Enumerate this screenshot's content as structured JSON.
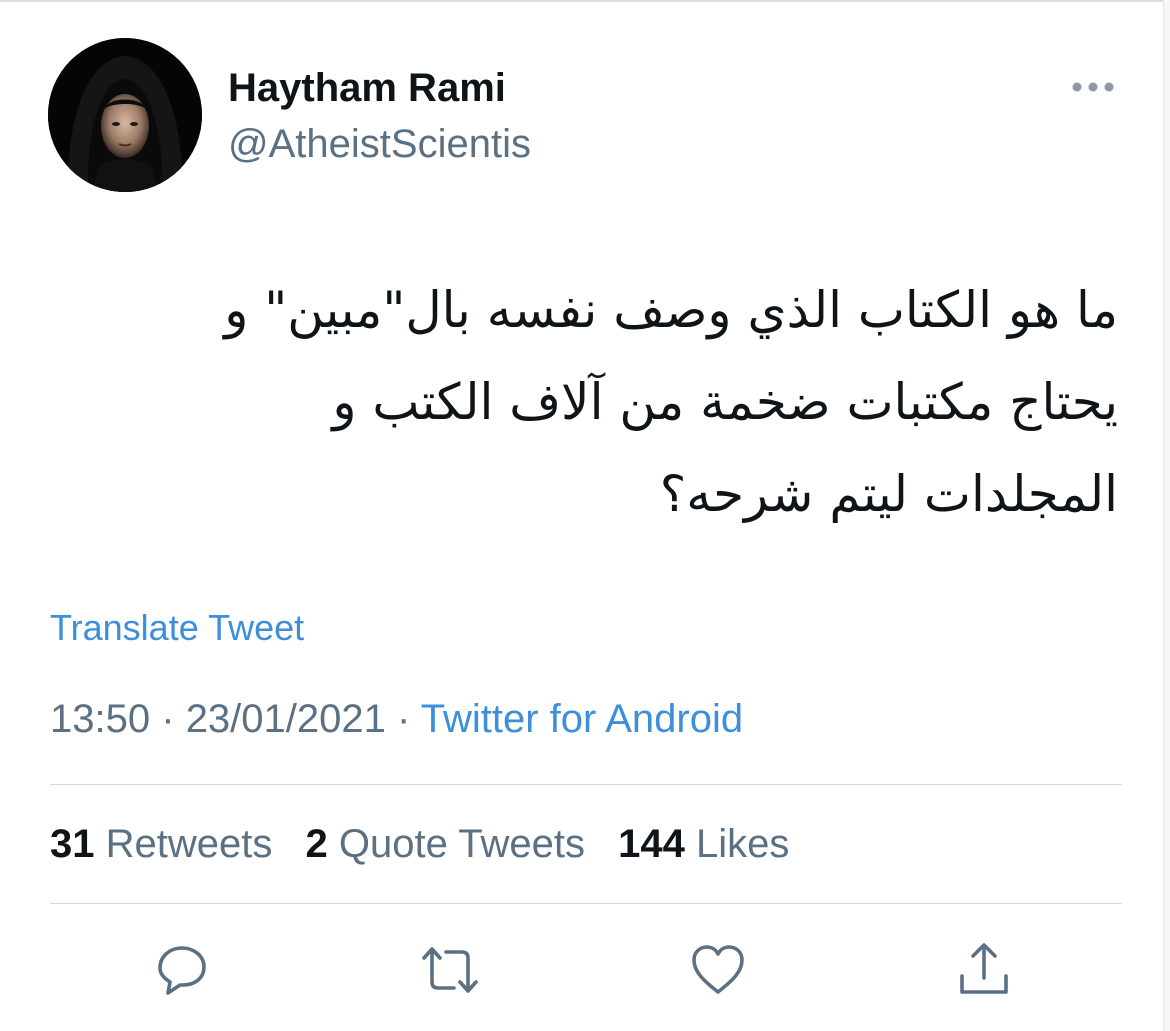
{
  "tweet": {
    "author_name": "Haytham Rami",
    "author_handle": "@AtheistScientis",
    "text_lines": [
      "ما هو الكتاب الذي وصف نفسه بال\"مبين\" و",
      "يحتاج مكتبات ضخمة من آلاف الكتب و",
      "المجلدات ليتم شرحه؟"
    ],
    "translate_label": "Translate Tweet",
    "time": "13:50",
    "separator": "·",
    "date": "23/01/2021",
    "source": "Twitter for Android"
  },
  "stats": {
    "retweets": {
      "count": "31",
      "label": "Retweets"
    },
    "quotes": {
      "count": "2",
      "label": "Quote Tweets"
    },
    "likes": {
      "count": "144",
      "label": "Likes"
    }
  },
  "icons": {
    "more": "more-horizontal-icon",
    "reply": "reply-icon",
    "retweet": "retweet-icon",
    "like": "heart-icon",
    "share": "share-icon"
  },
  "colors": {
    "link": "#3d8fd9",
    "secondary_text": "#5b7083",
    "primary_text": "#0f1419",
    "icon": "#5b7083"
  }
}
